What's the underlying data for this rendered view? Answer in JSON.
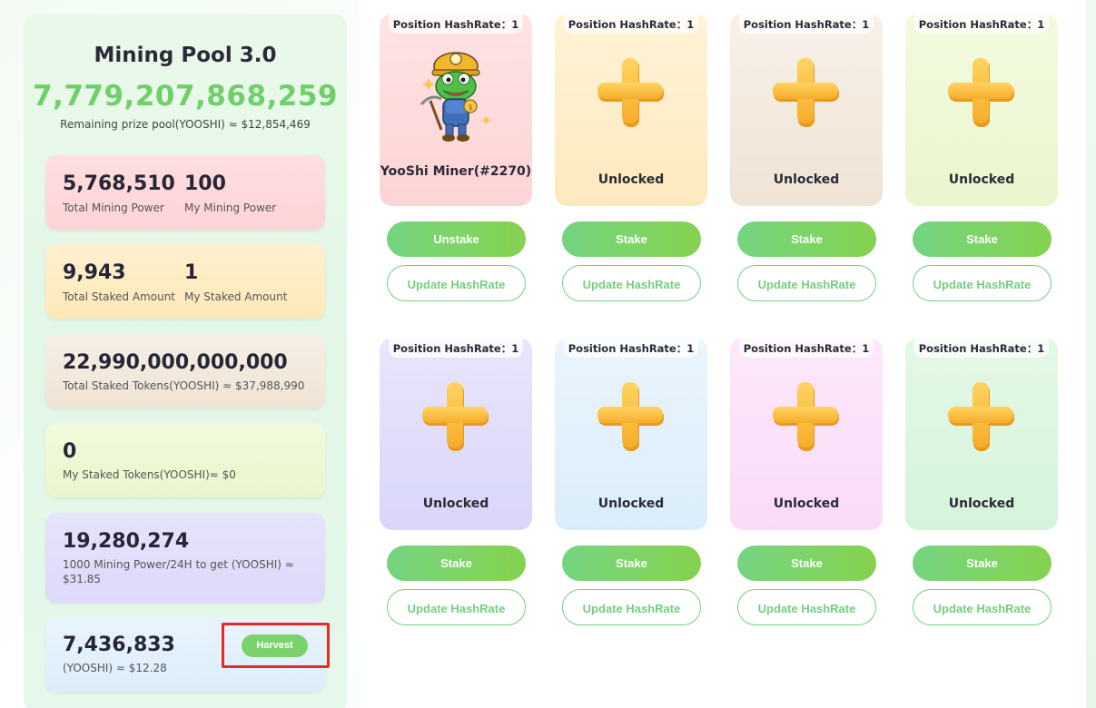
{
  "pool": {
    "title": "Mining Pool 3.0",
    "total_prize": "7,779,207,868,259",
    "remaining_label": "Remaining prize pool(YOOSHI) ≈ $12,854,469"
  },
  "stats": {
    "total_mining_power": "5,768,510",
    "total_mining_power_label": "Total Mining Power",
    "my_mining_power": "100",
    "my_mining_power_label": "My Mining Power",
    "total_staked_amount": "9,943",
    "total_staked_amount_label": "Total Staked Amount",
    "my_staked_amount": "1",
    "my_staked_amount_label": "My Staked Amount",
    "total_staked_tokens": "22,990,000,000,000",
    "total_staked_tokens_label": "Total Staked Tokens(YOOSHI) ≈ $37,988,990",
    "my_staked_tokens": "0",
    "my_staked_tokens_label": "My Staked Tokens(YOOSHI)≈ $0",
    "reward_rate": "19,280,274",
    "reward_rate_label": "1000 Mining Power/24H to get (YOOSHI) ≈ $31.85",
    "pending": "7,436,833",
    "pending_label": "(YOOSHI) ≈ $12.28",
    "harvest_label": "Harvest"
  },
  "slots": [
    {
      "badge": "Position HashRate：1",
      "label": "YooShi Miner(#2270)",
      "action": "Unstake",
      "update": "Update HashRate",
      "icon": "yooshi-miner-nft"
    },
    {
      "badge": "Position HashRate：1",
      "label": "Unlocked",
      "action": "Stake",
      "update": "Update HashRate",
      "icon": "plus-icon"
    },
    {
      "badge": "Position HashRate：1",
      "label": "Unlocked",
      "action": "Stake",
      "update": "Update HashRate",
      "icon": "plus-icon"
    },
    {
      "badge": "Position HashRate：1",
      "label": "Unlocked",
      "action": "Stake",
      "update": "Update HashRate",
      "icon": "plus-icon"
    },
    {
      "badge": "Position HashRate：1",
      "label": "Unlocked",
      "action": "Stake",
      "update": "Update HashRate",
      "icon": "plus-icon"
    },
    {
      "badge": "Position HashRate：1",
      "label": "Unlocked",
      "action": "Stake",
      "update": "Update HashRate",
      "icon": "plus-icon"
    },
    {
      "badge": "Position HashRate：1",
      "label": "Unlocked",
      "action": "Stake",
      "update": "Update HashRate",
      "icon": "plus-icon"
    },
    {
      "badge": "Position HashRate：1",
      "label": "Unlocked",
      "action": "Stake",
      "update": "Update HashRate",
      "icon": "plus-icon"
    }
  ],
  "colors": {
    "accent_green": "#6fd069",
    "highlight_red": "#e52b22",
    "plus_yellow": "#fbbf3c"
  }
}
